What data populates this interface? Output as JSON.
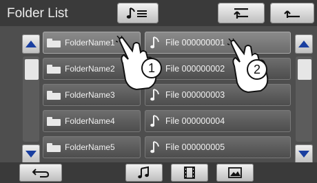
{
  "header": {
    "title": "Folder List",
    "buttons": [
      {
        "icon": "music-list-icon"
      },
      {
        "icon": "upper-folder-icon"
      },
      {
        "icon": "return-icon"
      }
    ]
  },
  "folders": [
    {
      "name": "FolderName1",
      "selected": true
    },
    {
      "name": "FolderName2",
      "selected": false
    },
    {
      "name": "FolderName3",
      "selected": false
    },
    {
      "name": "FolderName4",
      "selected": false
    },
    {
      "name": "FolderName5",
      "selected": false
    }
  ],
  "files": [
    {
      "name": "File 000000001",
      "selected": true
    },
    {
      "name": "File 000000002",
      "selected": false
    },
    {
      "name": "File 000000003",
      "selected": false
    },
    {
      "name": "File 000000004",
      "selected": false
    },
    {
      "name": "File 000000005",
      "selected": false
    }
  ],
  "bottom": {
    "buttons": [
      {
        "icon": "back-icon"
      },
      {
        "icon": "music-icon"
      },
      {
        "icon": "video-icon"
      },
      {
        "icon": "picture-icon"
      }
    ]
  },
  "callouts": [
    "1",
    "2"
  ],
  "colors": {
    "background": "#4e4e4e",
    "button": "#d6d6d6",
    "text": "#f2f2f2"
  }
}
